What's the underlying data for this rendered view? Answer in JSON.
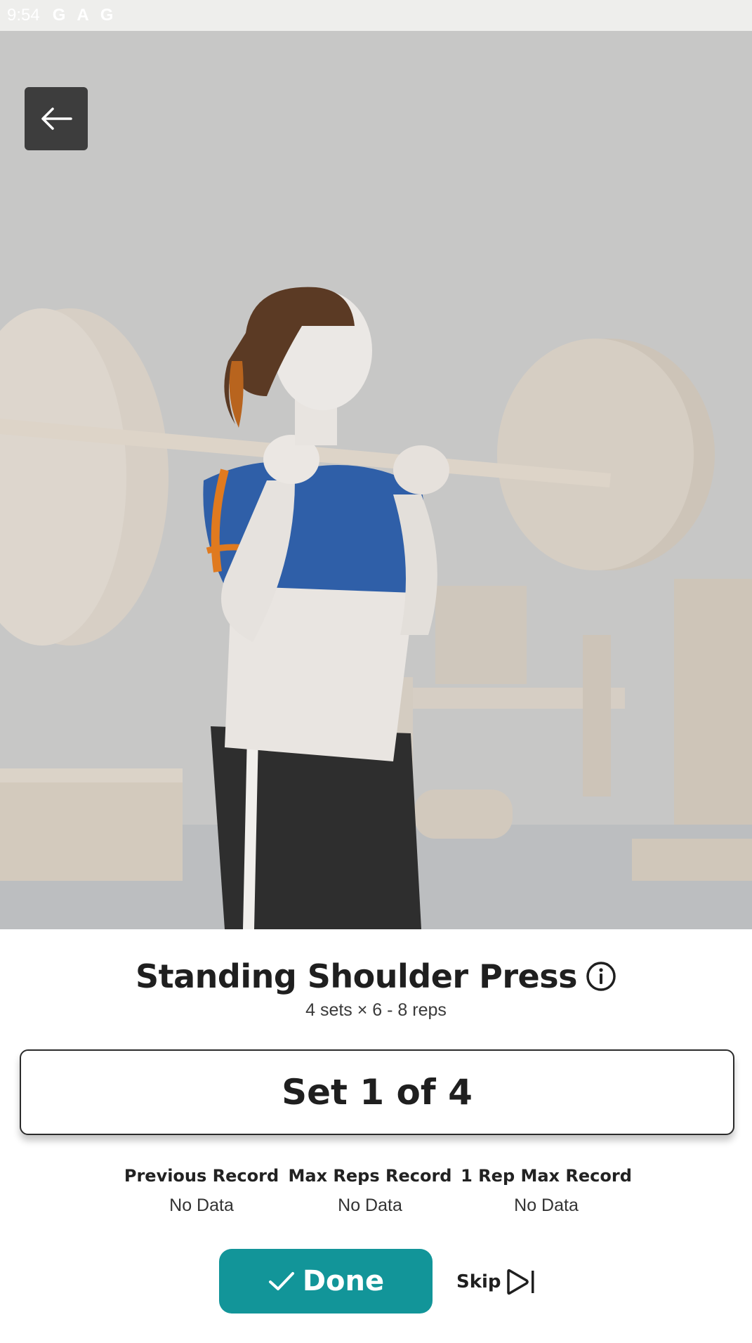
{
  "status_bar": {
    "time": "9:54",
    "icons": [
      "G",
      "A",
      "G"
    ]
  },
  "nav": {
    "back_icon": "arrow-left-icon"
  },
  "exercise": {
    "name": "Standing Shoulder Press",
    "info_icon": "info-icon",
    "prescription": "4 sets × 6 - 8 reps"
  },
  "set_indicator": {
    "label": "Set 1 of 4"
  },
  "records": [
    {
      "label": "Previous Record",
      "value": "No Data"
    },
    {
      "label": "Max Reps Record",
      "value": "No Data"
    },
    {
      "label": "1 Rep Max Record",
      "value": "No Data"
    }
  ],
  "actions": {
    "done_label": "Done",
    "done_icon": "check-icon",
    "skip_label": "Skip",
    "skip_icon": "skip-next-icon"
  },
  "colors": {
    "accent": "#129599",
    "hero_bg": "#c7c7c6",
    "shirt": "#2f5fa8",
    "stripe": "#e07a1f"
  }
}
